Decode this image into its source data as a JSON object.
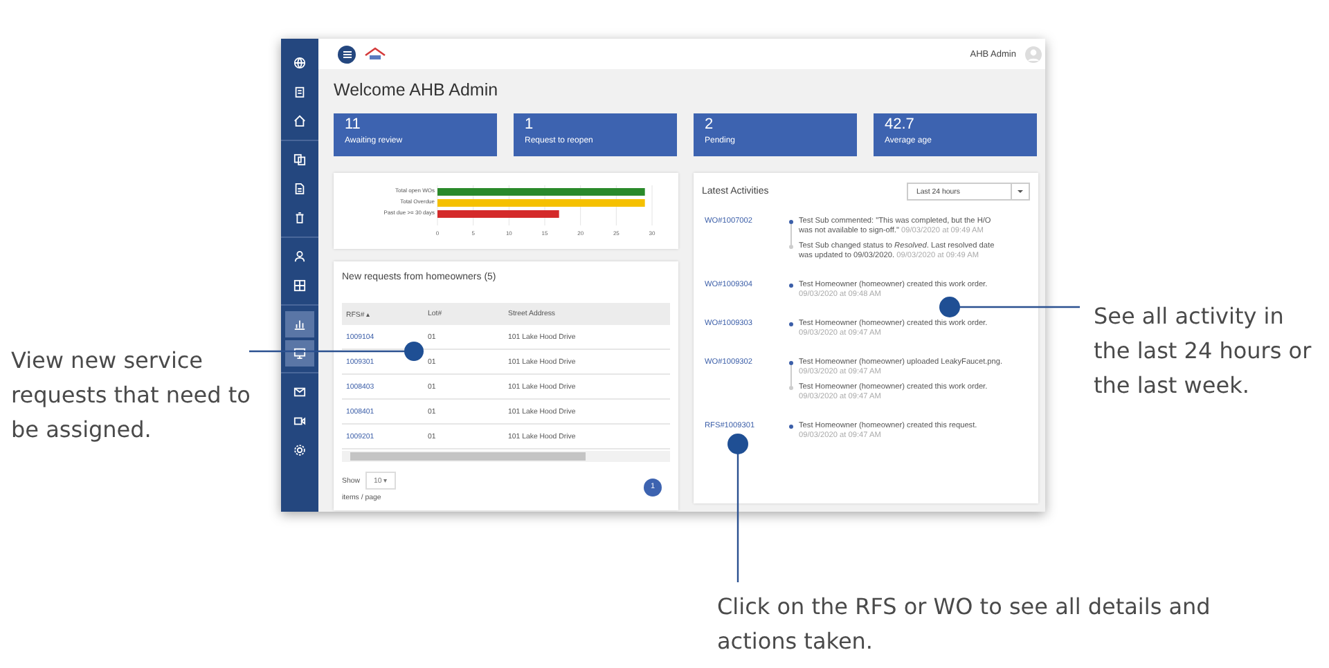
{
  "sidebar": {
    "items": [
      {
        "selected": false
      },
      {
        "selected": false
      },
      {
        "selected": false
      },
      {
        "selected": false
      },
      {
        "selected": false
      },
      {
        "selected": false
      },
      {
        "selected": false
      },
      {
        "selected": false
      },
      {
        "selected": true
      },
      {
        "selected": true
      },
      {
        "selected": false
      },
      {
        "selected": false
      },
      {
        "selected": false
      }
    ]
  },
  "topbar": {
    "user": "AHB Admin"
  },
  "title": "Welcome AHB Admin",
  "stats": [
    {
      "value": "11",
      "label": "Awaiting review"
    },
    {
      "value": "1",
      "label": "Request to reopen"
    },
    {
      "value": "2",
      "label": "Pending"
    },
    {
      "value": "42.7",
      "label": "Average age"
    }
  ],
  "overview_chart": {
    "chart_data": {
      "type": "bar",
      "orientation": "horizontal",
      "categories": [
        "Total open WOs",
        "Total Overdue",
        "Past due >= 30 days"
      ],
      "values": [
        29,
        29,
        17
      ],
      "xlim": [
        0,
        30
      ],
      "xticks": [
        0,
        5,
        10,
        15,
        20,
        25,
        30
      ],
      "colors": [
        "#2a8a2a",
        "#f5c000",
        "#d42a2a"
      ],
      "grid": true
    }
  },
  "requests": {
    "title": "New requests from homeowners (5)",
    "columns": [
      "RFS# ▴",
      "Lot#",
      "Street Address"
    ],
    "rows": [
      [
        "1009104",
        "01",
        "101 Lake Hood Drive"
      ],
      [
        "1009301",
        "01",
        "101 Lake Hood Drive"
      ],
      [
        "1008403",
        "01",
        "101 Lake Hood Drive"
      ],
      [
        "1008401",
        "01",
        "101 Lake Hood Drive"
      ],
      [
        "1009201",
        "01",
        "101 Lake Hood Drive"
      ]
    ],
    "show_label": "Show",
    "page_size": "10 ▾",
    "items_label": "items / page",
    "page": "1"
  },
  "activities": {
    "title": "Latest Activities",
    "period": "Last 24 hours",
    "groups": [
      {
        "ref": "WO#1007002",
        "events": [
          {
            "text": "Test Sub commented: \"This was completed, but the H/O was not available to sign-off.\"",
            "time": "09/03/2020 at 09:49 AM"
          },
          {
            "text": "Test Sub changed status to *Resolved*. Last resolved date was updated to 09/03/2020.",
            "time": "09/03/2020 at 09:49 AM"
          }
        ]
      },
      {
        "ref": "WO#1009304",
        "events": [
          {
            "text": "Test Homeowner (homeowner) created this work order.",
            "time": "09/03/2020 at 09:48 AM"
          }
        ]
      },
      {
        "ref": "WO#1009303",
        "events": [
          {
            "text": "Test Homeowner (homeowner) created this work order.",
            "time": "09/03/2020 at 09:47 AM"
          }
        ]
      },
      {
        "ref": "WO#1009302",
        "events": [
          {
            "text": "Test Homeowner (homeowner) uploaded LeakyFaucet.png.",
            "time": "09/03/2020 at 09:47 AM"
          },
          {
            "text": "Test Homeowner (homeowner) created this work order.",
            "time": "09/03/2020 at 09:47 AM"
          }
        ]
      },
      {
        "ref": "RFS#1009301",
        "events": [
          {
            "text": "Test Homeowner (homeowner) created this request.",
            "time": "09/03/2020 at 09:47 AM"
          }
        ]
      }
    ]
  },
  "callouts": [
    {
      "text": "View new service requests that need to be assigned."
    },
    {
      "text": "See all activity in the last 24 hours or the last week."
    },
    {
      "text": "Click on the RFS or WO to see all details and actions taken."
    }
  ]
}
